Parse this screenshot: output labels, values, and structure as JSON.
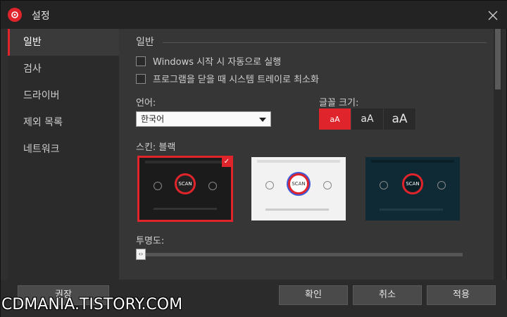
{
  "window": {
    "title": "설정"
  },
  "sidebar": {
    "items": [
      {
        "label": "일반",
        "active": true
      },
      {
        "label": "검사",
        "active": false
      },
      {
        "label": "드라이버",
        "active": false
      },
      {
        "label": "제외 목록",
        "active": false
      },
      {
        "label": "네트워크",
        "active": false
      }
    ]
  },
  "general": {
    "section_title": "일반",
    "checkboxes": [
      {
        "label": "Windows 시작 시 자동으로 실행",
        "checked": false
      },
      {
        "label": "프로그램을 닫을 때 시스템 트레이로 최소화",
        "checked": false
      }
    ],
    "language_label": "언어:",
    "language_value": "한국어",
    "fontsize_label": "글꼴 크기:",
    "fontsize_options": [
      "aA",
      "aA",
      "aA"
    ],
    "fontsize_selected": 0,
    "skin_label": "스킨: 블랙",
    "skins": [
      {
        "name": "black",
        "scan_label": "SCAN",
        "selected": true
      },
      {
        "name": "white",
        "scan_label": "SCAN",
        "selected": false
      },
      {
        "name": "teal",
        "scan_label": "SCAN",
        "selected": false
      }
    ],
    "transparency_label": "투명도:",
    "transparency_value": 0
  },
  "footer": {
    "recommend_label": "권장",
    "ok_label": "확인",
    "cancel_label": "취소",
    "apply_label": "적용"
  },
  "watermark": "CDMANIA.TISTORY.COM",
  "colors": {
    "accent": "#e0242b",
    "background": "#363636",
    "sidebar": "#2b2b2b"
  }
}
